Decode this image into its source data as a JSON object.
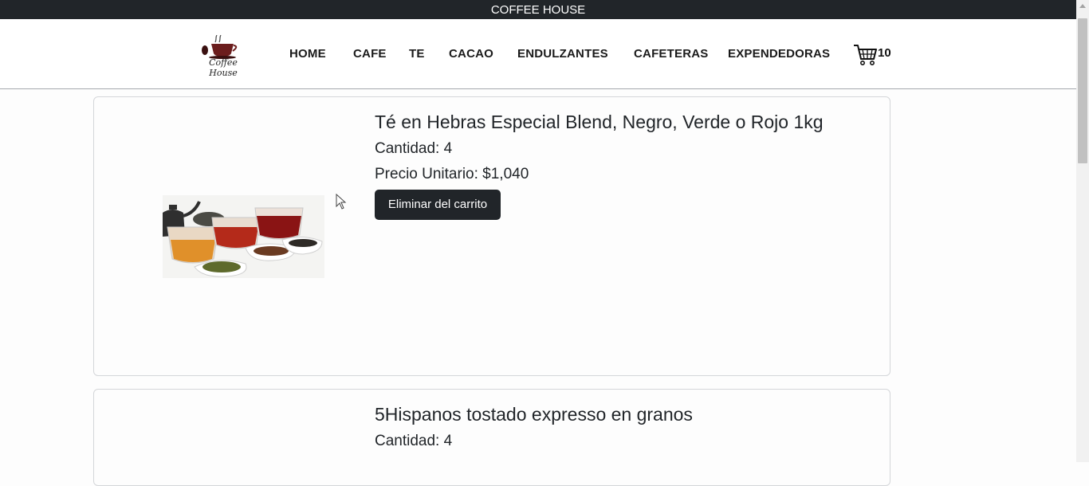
{
  "topbar": {
    "title": "COFFEE HOUSE"
  },
  "navbar": {
    "logo_text": "Coffee House",
    "items": [
      {
        "label": "HOME"
      },
      {
        "label": "CAFE"
      },
      {
        "label": "TE"
      },
      {
        "label": "CACAO"
      },
      {
        "label": "ENDULZANTES"
      },
      {
        "label": "CAFETERAS"
      },
      {
        "label": "EXPENDEDORAS"
      }
    ],
    "cart_icon": "cart-icon",
    "cart_count": "10"
  },
  "cart_items": [
    {
      "name": "Té en Hebras Especial Blend, Negro, Verde o Rojo 1kg",
      "quantity": "Cantidad: 4",
      "unit_price": "Precio Unitario: $1,040",
      "remove_label": "Eliminar del carrito",
      "image": "tea-cups-image"
    },
    {
      "name": "5Hispanos tostado expresso en granos",
      "quantity": "Cantidad: 4"
    }
  ]
}
